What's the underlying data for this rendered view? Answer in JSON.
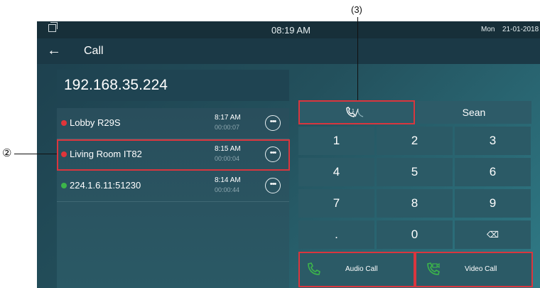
{
  "status_bar": {
    "time": "08:19 AM",
    "day": "Mon",
    "date": "21-01-2018"
  },
  "title_bar": {
    "back_icon": "←",
    "title": "Call"
  },
  "dial_input": {
    "value": "192.168.35.224"
  },
  "call_log": [
    {
      "name": "Lobby R29S",
      "time": "8:17 AM",
      "duration": "00:00:07",
      "status": "missed",
      "color": "#e0353a"
    },
    {
      "name": "Living Room IT82",
      "time": "8:15 AM",
      "duration": "00:00:04",
      "status": "missed",
      "color": "#e0353a"
    },
    {
      "name": "224.1.6.11:51230",
      "time": "8:14 AM",
      "duration": "00:00:44",
      "status": "answered",
      "color": "#3cb54a"
    }
  ],
  "tabs": {
    "call_type_icon": "call-log-icon",
    "contact": "Sean"
  },
  "keypad": {
    "keys": [
      "1",
      "2",
      "3",
      "4",
      "5",
      "6",
      "7",
      "8",
      "9",
      ".",
      "0",
      "⌫"
    ]
  },
  "actions": {
    "audio_call": "Audio Call",
    "video_call": "Video Call"
  },
  "callouts": {
    "two": "②",
    "three": "(3)"
  },
  "colors": {
    "highlight": "#d9363e",
    "accent_green": "#3cb54a"
  }
}
